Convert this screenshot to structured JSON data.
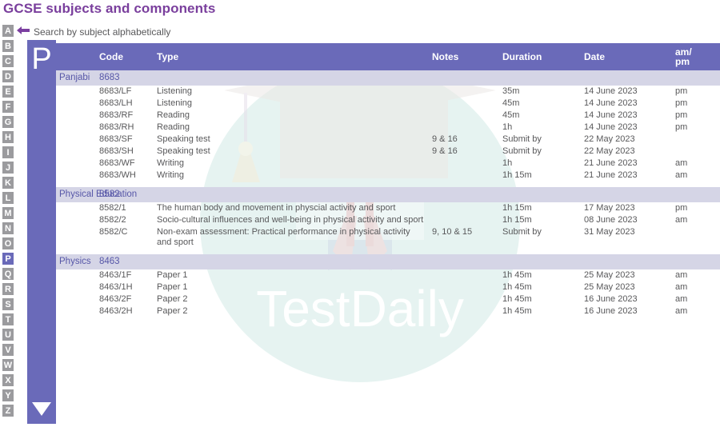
{
  "page": {
    "title": "GCSE subjects and components",
    "title_color": "#7a3f9d",
    "accent_color": "#6a6ab9",
    "subject_row_color": "#d5d5e6",
    "watermark_text": "TestDaily"
  },
  "search_hint": {
    "icon": "arrow-left-icon",
    "text": "Search by subject alphabetically"
  },
  "alphabet": {
    "letters": [
      "A",
      "B",
      "C",
      "D",
      "E",
      "F",
      "G",
      "H",
      "I",
      "J",
      "K",
      "L",
      "M",
      "N",
      "O",
      "P",
      "Q",
      "R",
      "S",
      "T",
      "U",
      "V",
      "W",
      "X",
      "Y",
      "Z"
    ],
    "active": "P"
  },
  "letter_panel": {
    "letter": "P",
    "scroll_icon": "triangle-down-icon"
  },
  "table": {
    "headers": {
      "subject": "",
      "code": "Code",
      "type": "Type",
      "notes": "Notes",
      "duration": "Duration",
      "date": "Date",
      "ampm_line1": "am/",
      "ampm_line2": "pm"
    },
    "subjects": [
      {
        "name": "Panjabi",
        "code": "8683",
        "components": [
          {
            "code": "8683/LF",
            "type": "Listening",
            "notes": "",
            "duration": "35m",
            "date": "14 June 2023",
            "ampm": "pm"
          },
          {
            "code": "8683/LH",
            "type": "Listening",
            "notes": "",
            "duration": "45m",
            "date": "14 June 2023",
            "ampm": "pm"
          },
          {
            "code": "8683/RF",
            "type": "Reading",
            "notes": "",
            "duration": "45m",
            "date": "14 June 2023",
            "ampm": "pm"
          },
          {
            "code": "8683/RH",
            "type": "Reading",
            "notes": "",
            "duration": "1h",
            "date": "14 June 2023",
            "ampm": "pm"
          },
          {
            "code": "8683/SF",
            "type": "Speaking test",
            "notes": "9 & 16",
            "duration": "Submit by",
            "date": "22 May 2023",
            "ampm": ""
          },
          {
            "code": "8683/SH",
            "type": "Speaking test",
            "notes": "9 & 16",
            "duration": "Submit by",
            "date": "22 May 2023",
            "ampm": ""
          },
          {
            "code": "8683/WF",
            "type": "Writing",
            "notes": "",
            "duration": "1h",
            "date": "21 June 2023",
            "ampm": "am"
          },
          {
            "code": "8683/WH",
            "type": "Writing",
            "notes": "",
            "duration": "1h 15m",
            "date": "21 June 2023",
            "ampm": "am"
          }
        ]
      },
      {
        "name": "Physical Education",
        "code": "8582",
        "components": [
          {
            "code": "8582/1",
            "type": "The human body and movement in physcial activity and sport",
            "notes": "",
            "duration": "1h 15m",
            "date": "17 May 2023",
            "ampm": "pm"
          },
          {
            "code": "8582/2",
            "type": "Socio-cultural influences and well-being in physical activity and sport",
            "notes": "",
            "duration": "1h 15m",
            "date": "08 June 2023",
            "ampm": "am"
          },
          {
            "code": "8582/C",
            "type": "Non-exam assessment: Practical performance in physical activity and sport",
            "notes": "9, 10 & 15",
            "duration": "Submit by",
            "date": "31 May 2023",
            "ampm": ""
          }
        ]
      },
      {
        "name": "Physics",
        "code": "8463",
        "components": [
          {
            "code": "8463/1F",
            "type": "Paper 1",
            "notes": "",
            "duration": "1h 45m",
            "date": "25 May 2023",
            "ampm": "am"
          },
          {
            "code": "8463/1H",
            "type": "Paper 1",
            "notes": "",
            "duration": "1h 45m",
            "date": "25 May 2023",
            "ampm": "am"
          },
          {
            "code": "8463/2F",
            "type": "Paper 2",
            "notes": "",
            "duration": "1h 45m",
            "date": "16 June 2023",
            "ampm": "am"
          },
          {
            "code": "8463/2H",
            "type": "Paper 2",
            "notes": "",
            "duration": "1h 45m",
            "date": "16 June 2023",
            "ampm": "am"
          }
        ]
      }
    ]
  }
}
